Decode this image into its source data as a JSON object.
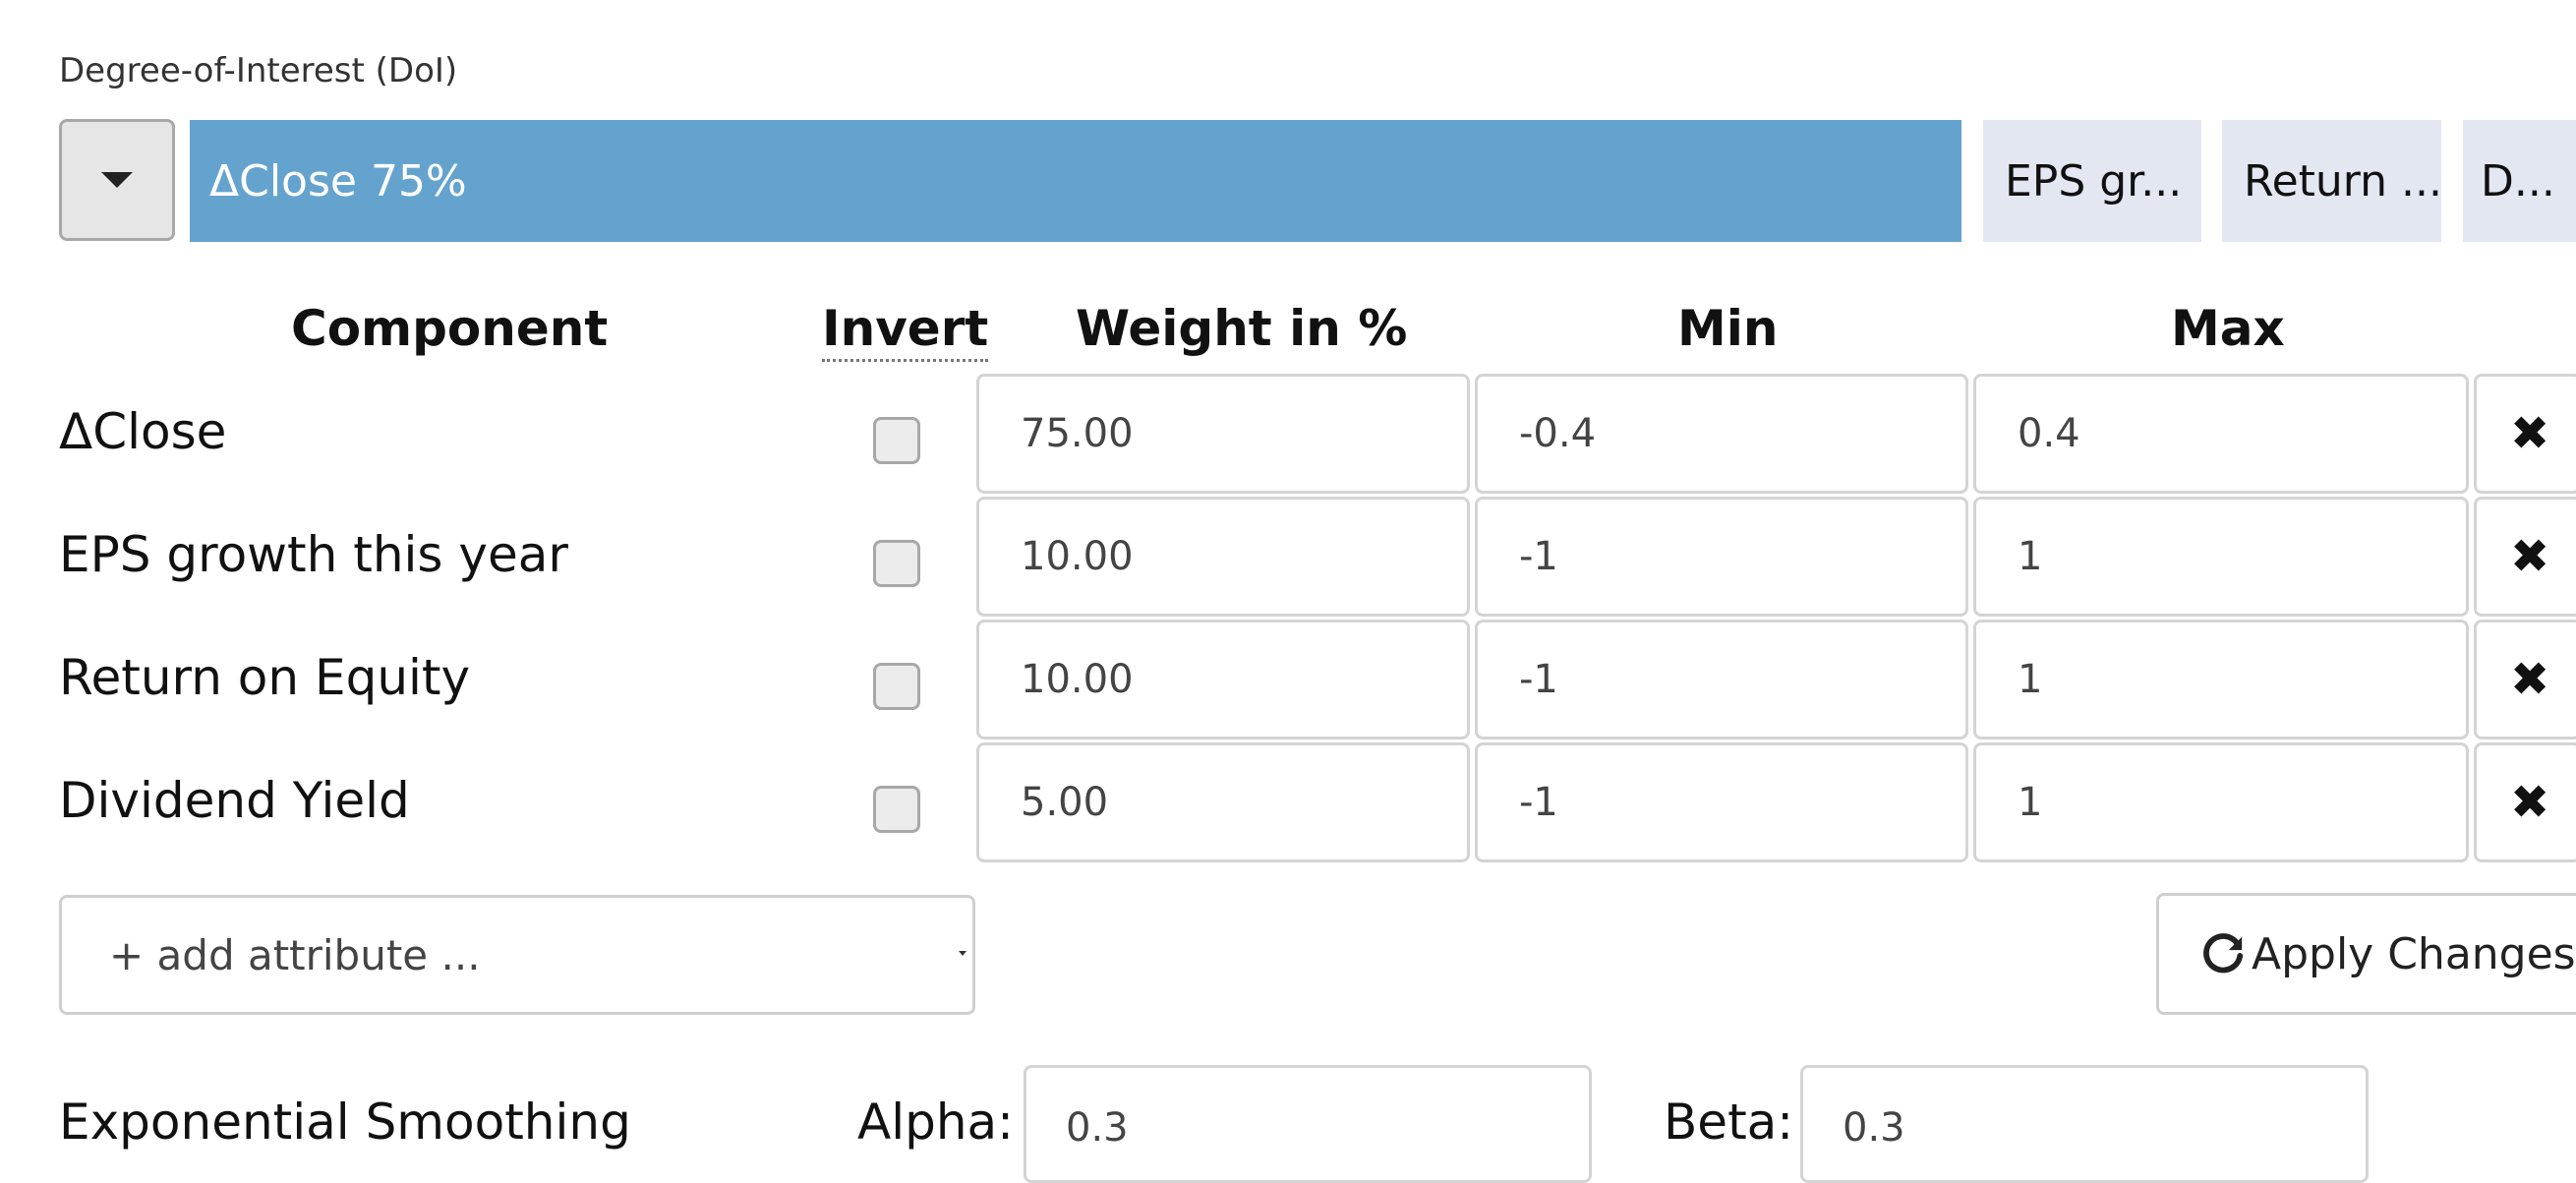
{
  "doi": {
    "label": "Degree-of-Interest (DoI)",
    "segments": [
      {
        "label": "ΔClose 75%",
        "color": "#65a3cf"
      },
      {
        "label": "EPS gr...",
        "color": "#e2e7f2"
      },
      {
        "label": "Return ...",
        "color": "#e2e7f2"
      },
      {
        "label": "D...",
        "color": "#e2e7f2"
      }
    ]
  },
  "table": {
    "headers": {
      "component": "Component",
      "invert": "Invert",
      "weight": "Weight in %",
      "min": "Min",
      "max": "Max"
    },
    "rows": [
      {
        "component": "ΔClose",
        "inverted": false,
        "weight": "75.00",
        "min": "-0.4",
        "max": "0.4"
      },
      {
        "component": "EPS growth this year",
        "inverted": false,
        "weight": "10.00",
        "min": "-1",
        "max": "1"
      },
      {
        "component": "Return on Equity",
        "inverted": false,
        "weight": "10.00",
        "min": "-1",
        "max": "1"
      },
      {
        "component": "Dividend Yield",
        "inverted": false,
        "weight": "5.00",
        "min": "-1",
        "max": "1"
      }
    ],
    "delete_glyph": "✖"
  },
  "add_attribute": {
    "label": "+ add attribute ..."
  },
  "apply_button": {
    "icon": "refresh-icon",
    "label": "Apply Changes"
  },
  "smoothing": {
    "label": "Exponential Smoothing",
    "alpha_label": "Alpha:",
    "alpha_value": "0.3",
    "beta_label": "Beta:",
    "beta_value": "0.3"
  }
}
